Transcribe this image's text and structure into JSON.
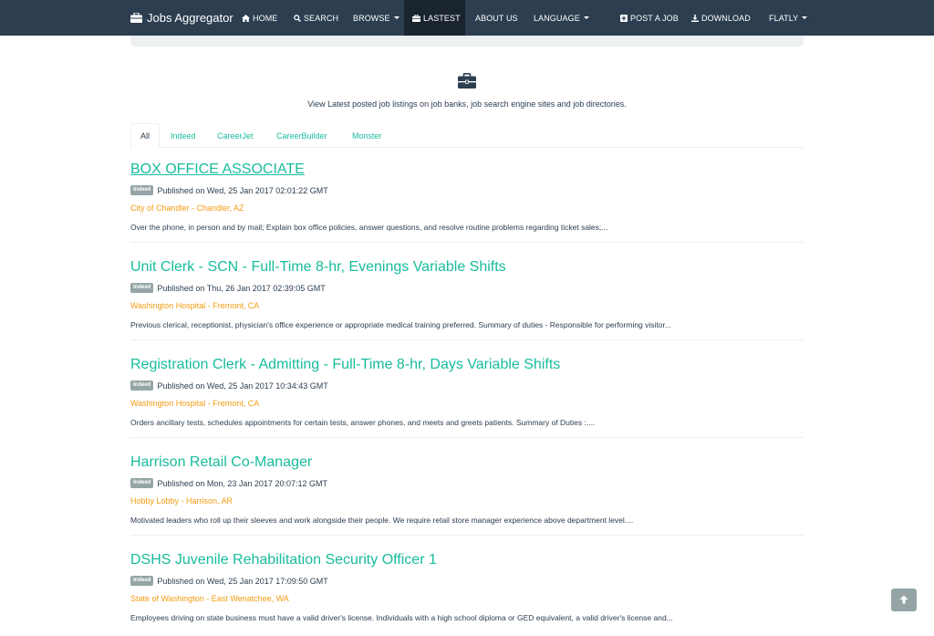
{
  "navbar": {
    "brand": "Jobs Aggregator",
    "items": [
      {
        "label": "HOME",
        "icon": "home-icon"
      },
      {
        "label": "SEARCH",
        "icon": "search-icon"
      },
      {
        "label": "BROWSE",
        "dropdown": true
      },
      {
        "label": "LASTEST",
        "icon": "briefcase-icon",
        "active": true
      },
      {
        "label": "ABOUT US"
      },
      {
        "label": "LANGUAGE",
        "dropdown": true
      },
      {
        "label": "POST A JOB",
        "icon": "plus-square-icon"
      },
      {
        "label": "DOWNLOAD",
        "icon": "download-icon"
      },
      {
        "label": "FLATLY",
        "dropdown": true
      }
    ]
  },
  "hero": {
    "icon": "briefcase-icon",
    "text": "View Latest posted job listings on job banks, job search engine sites and job directories."
  },
  "tabs": [
    "All",
    "Indeed",
    "CareerJet",
    "CareerBuilder",
    "Monster"
  ],
  "active_tab": "All",
  "jobs": [
    {
      "title": "BOX OFFICE ASSOCIATE",
      "source": "Indeed",
      "published": "Published on Wed, 25 Jan 2017 02:01:22 GMT",
      "company": "City of Chandler - Chandler, AZ",
      "description": "Over the phone, in person and by mail; Explain box office policies, answer questions, and resolve routine problems regarding ticket sales;..."
    },
    {
      "title": "Unit Clerk - SCN - Full-Time 8-hr, Evenings Variable Shifts",
      "source": "Indeed",
      "published": "Published on Thu, 26 Jan 2017 02:39:05 GMT",
      "company": "Washington Hospital - Fremont, CA",
      "description": "Previous clerical, receptionist, physician's office experience or appropriate medical training preferred. Summary of duties - Responsible for performing visitor..."
    },
    {
      "title": "Registration Clerk - Admitting - Full-Time 8-hr, Days Variable Shifts",
      "source": "Indeed",
      "published": "Published on Wed, 25 Jan 2017 10:34:43 GMT",
      "company": "Washington Hospital - Fremont, CA",
      "description": "Orders ancillary tests, schedules appointments for certain tests, answer phones, and meets and greets patients. Summary of Duties :...."
    },
    {
      "title": "Harrison Retail Co-Manager",
      "source": "Indeed",
      "published": "Published on Mon, 23 Jan 2017 20:07:12 GMT",
      "company": "Hobby Lobby - Harrison, AR",
      "description": "Motivated leaders who roll up their sleeves and work alongside their people. We require retail store manager experience above department level...."
    },
    {
      "title": "DSHS Juvenile Rehabilitation Security Officer 1",
      "source": "Indeed",
      "published": "Published on Wed, 25 Jan 2017 17:09:50 GMT",
      "company": "State of Washington - East Wenatchee, WA",
      "description": "Employees driving on state business must have a valid driver's license. Individuals with a high school diploma or GED equivalent, a valid driver's license and..."
    }
  ],
  "back_to_top": {
    "icon": "arrow-up-icon"
  },
  "colors": {
    "navbar": "#2c3e50",
    "navbar_active": "#1a242f",
    "accent": "#18bc9c",
    "company": "#f39c12",
    "badge": "#95a5a6"
  }
}
